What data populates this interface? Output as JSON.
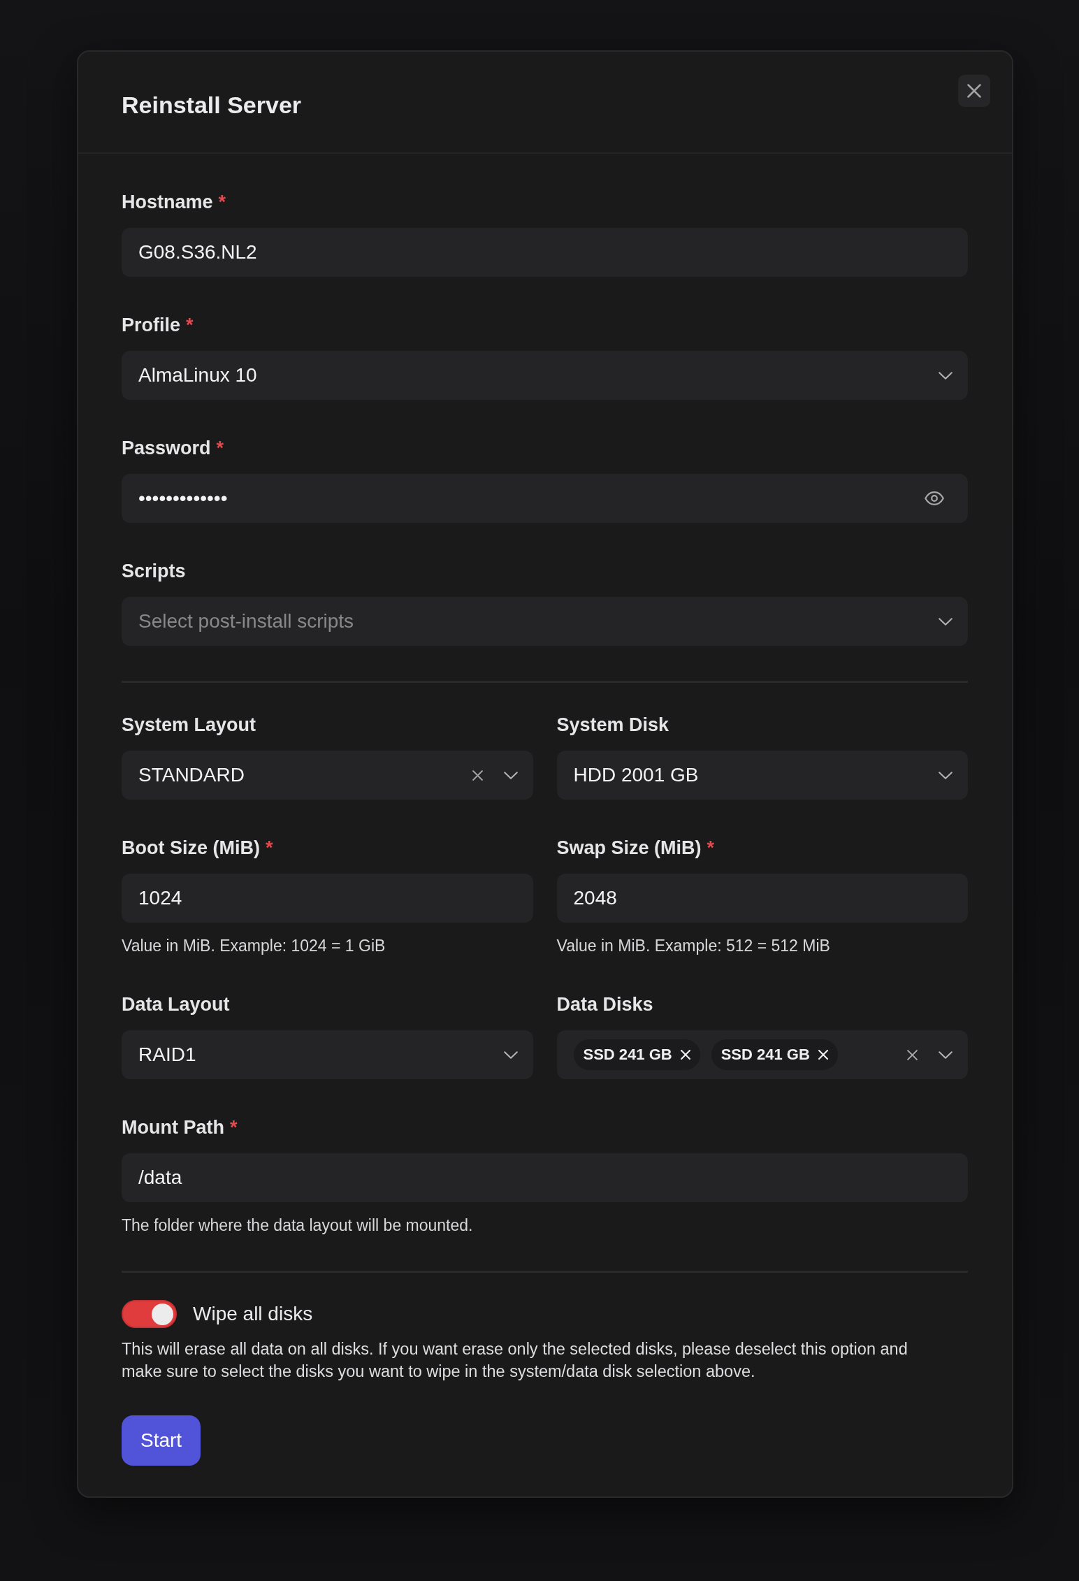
{
  "dialog": {
    "title": "Reinstall Server"
  },
  "general_fields": [
    {
      "kind": "text",
      "label": "Hostname",
      "required_mark": "*",
      "value": "G08.S36.NL2"
    },
    {
      "kind": "select",
      "label": "Profile",
      "required_mark": "*",
      "value": "AlmaLinux 10",
      "clearable": false
    },
    {
      "kind": "password",
      "label": "Password",
      "required_mark": "*",
      "value": "•••••••••••••"
    },
    {
      "kind": "select",
      "label": "Scripts",
      "placeholder": "Select post-install scripts",
      "clearable": false
    }
  ],
  "disk_fields": [
    {
      "kind": "select",
      "label": "System Layout",
      "value": "STANDARD",
      "clearable": true
    },
    {
      "kind": "select",
      "label": "System Disk",
      "value": "HDD 2001 GB",
      "clearable": false
    },
    {
      "kind": "text",
      "label": "Boot Size (MiB)",
      "required_mark": "*",
      "value": "1024",
      "help": "Value in MiB. Example: 1024 = 1 GiB"
    },
    {
      "kind": "text",
      "label": "Swap Size (MiB)",
      "required_mark": "*",
      "value": "2048",
      "help": "Value in MiB. Example: 512 = 512 MiB"
    },
    {
      "kind": "select",
      "label": "Data Layout",
      "value": "RAID1",
      "clearable": false
    },
    {
      "kind": "multiselect",
      "label": "Data Disks",
      "chips": [
        "SSD 241 GB",
        "SSD 241 GB"
      ],
      "clearable": true
    }
  ],
  "path_fields": [
    {
      "kind": "text",
      "label": "Mount Path",
      "required_mark": "*",
      "value": "/data",
      "help": "The folder where the data layout will be mounted."
    }
  ],
  "wipe": {
    "label": "Wipe all disks",
    "on": true,
    "description": "This will erase all data on all disks. If you want erase only the selected disks, please deselect this option and make sure to select the disks you want to wipe in the system/data disk selection above."
  },
  "actions": [
    {
      "label": "Start",
      "kind": "primary"
    }
  ]
}
